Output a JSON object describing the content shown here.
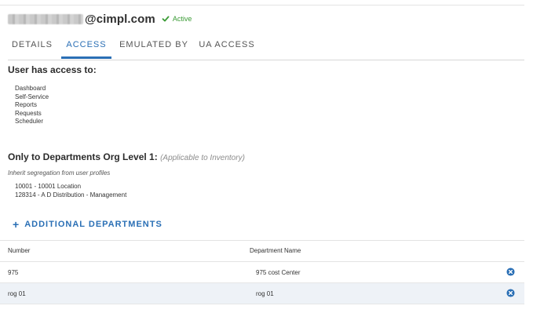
{
  "header": {
    "email_domain": "@cimpl.com",
    "status": "Active",
    "colors": {
      "status_green": "#3a9b35",
      "accent_blue": "#2a6fb5"
    }
  },
  "tabs": [
    {
      "label": "DETAILS",
      "active": false
    },
    {
      "label": "ACCESS",
      "active": true
    },
    {
      "label": "EMULATED BY",
      "active": false
    },
    {
      "label": "UA ACCESS",
      "active": false
    }
  ],
  "access": {
    "title": "User has access to:",
    "items": [
      "Dashboard",
      "Self-Service",
      "Reports",
      "Requests",
      "Scheduler"
    ]
  },
  "departments": {
    "title": "Only to Departments Org Level 1:",
    "note": "(Applicable to Inventory)",
    "inherit_label": "Inherit segregation from user profiles",
    "items": [
      "10001 - 10001 Location",
      "128314 - A D Distribution - Management"
    ],
    "add_label": "ADDITIONAL DEPARTMENTS",
    "add_icon": "plus-icon"
  },
  "table": {
    "columns": [
      "Number",
      "Department Name"
    ],
    "rows": [
      {
        "number": "975",
        "name": "975 cost Center"
      },
      {
        "number": "rog 01",
        "name": "rog 01"
      }
    ],
    "row_action_icon": "remove-circle-icon"
  }
}
